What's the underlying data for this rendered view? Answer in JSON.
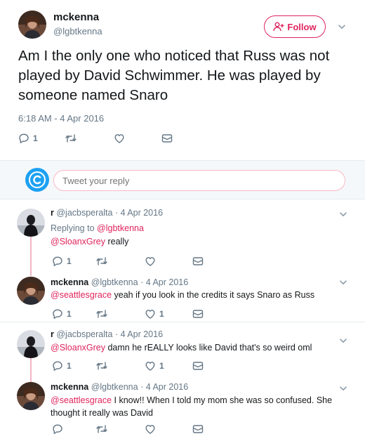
{
  "tweet": {
    "name": "mckenna",
    "handle": "@lgbtkenna",
    "follow_label": "Follow",
    "text": "Am I the only one who noticed that Russ was not played by David Schwimmer. He was played by someone named Snaro",
    "timestamp": "6:18 AM - 4 Apr 2016",
    "reply_count": "1",
    "retweet_count": "",
    "like_count": ""
  },
  "reply_box": {
    "placeholder": "Tweet your reply"
  },
  "replies": [
    {
      "name": "r",
      "handle": "@jacbsperalta",
      "date": "· 4 Apr 2016",
      "replying_prefix": "Replying to",
      "replying_to": "@lgbtkenna",
      "mention": "@SloanxGrey",
      "text": " really",
      "reply_count": "1",
      "like_count": ""
    },
    {
      "name": "mckenna",
      "handle": "@lgbtkenna",
      "date": "· 4 Apr 2016",
      "mention": "@seattlesgrace",
      "text": " yeah if you look in the credits it says Snaro as Russ",
      "reply_count": "1",
      "like_count": "1"
    },
    {
      "name": "r",
      "handle": "@jacbsperalta",
      "date": "· 4 Apr 2016",
      "mention": "@SloanxGrey",
      "text": " damn he rEALLY looks like David that's so weird oml",
      "reply_count": "1",
      "like_count": "1"
    },
    {
      "name": "mckenna",
      "handle": "@lgbtkenna",
      "date": "· 4 Apr 2016",
      "mention": "@seattlesgrace",
      "text": " I know!! When I told my mom she was so confused. She thought it really was David",
      "reply_count": "",
      "like_count": ""
    }
  ],
  "colors": {
    "accent": "#e0245e",
    "muted": "#657786",
    "thread_line": "#f2b6c6"
  },
  "icons": [
    "reply-icon",
    "retweet-icon",
    "like-icon",
    "dm-icon",
    "chevron-down-icon",
    "follow-person-icon"
  ]
}
